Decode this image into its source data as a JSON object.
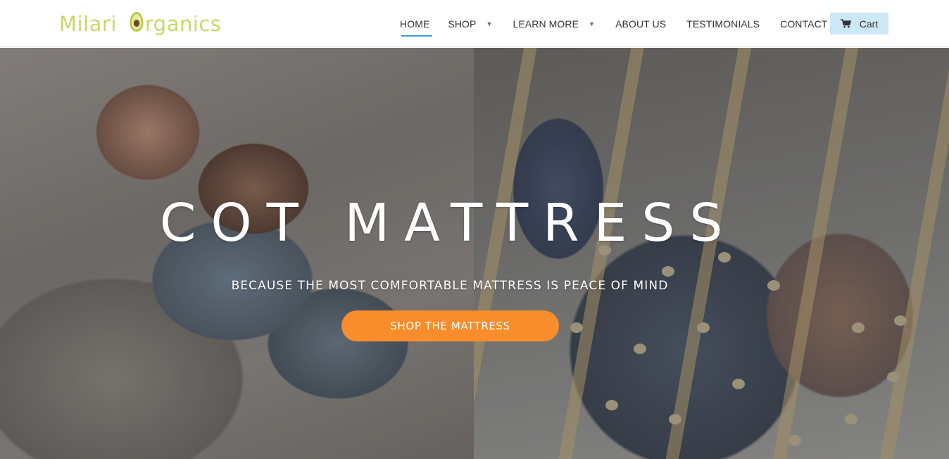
{
  "brand": {
    "name_part1": "Milari",
    "name_part2": "rganics",
    "logo_color": "#c9d866",
    "logo_icon": "avocado-icon"
  },
  "nav": {
    "items": [
      {
        "label": "HOME",
        "active": true
      },
      {
        "label": "SHOP",
        "dropdown": true
      },
      {
        "label": "LEARN MORE",
        "dropdown": true
      },
      {
        "label": "ABOUT US"
      },
      {
        "label": "TESTIMONIALS"
      },
      {
        "label": "CONTACT US"
      }
    ],
    "active_color": "#3aa0cf",
    "caret_icon": "caret-down-icon"
  },
  "cart": {
    "label": "Cart",
    "icon": "shopping-cart-icon",
    "bg_color": "#cde8f6"
  },
  "hero": {
    "title": "COT MATTRESS",
    "subtitle": "BECAUSE THE MOST COMFORTABLE MATTRESS IS PEACE OF MIND",
    "cta_label": "SHOP THE MATTRESS",
    "cta_color": "#f98c2b"
  }
}
